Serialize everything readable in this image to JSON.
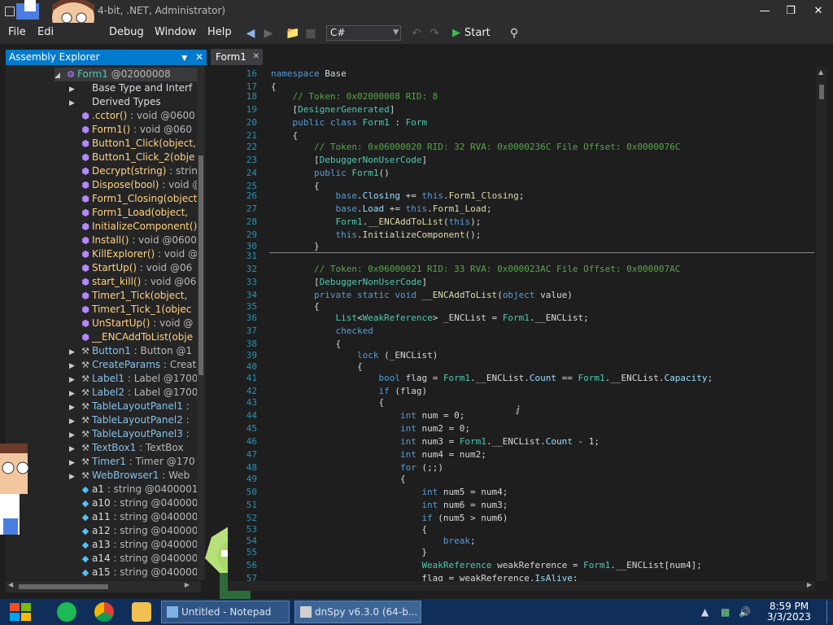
{
  "window": {
    "title": "4-bit, .NET, Administrator)",
    "minimize_label": "—",
    "maximize_label": "❐",
    "close_label": "✕"
  },
  "menu": {
    "file": "File",
    "edit": "Edi",
    "debug": "Debug",
    "window": "Window",
    "help": "Help"
  },
  "toolbar": {
    "language": "C#",
    "start_label": "Start",
    "icons": [
      "back-icon",
      "forward-icon",
      "open-folder-icon",
      "save-icon",
      "undo-icon",
      "redo-icon",
      "play-icon",
      "search-icon"
    ]
  },
  "assembly_explorer": {
    "title": "Assembly Explorer",
    "rows": [
      {
        "indent": 2,
        "expander": "◢",
        "icon": "class-icon",
        "name": "Form1",
        "sig": " @02000008",
        "kind": "type",
        "selected": true
      },
      {
        "indent": 3,
        "expander": "▶",
        "icon": "folder-icon",
        "name": "Base Type and Interf",
        "sig": "",
        "kind": "plain"
      },
      {
        "indent": 3,
        "expander": "▶",
        "icon": "folder-icon",
        "name": "Derived Types",
        "sig": "",
        "kind": "plain"
      },
      {
        "indent": 3,
        "expander": "",
        "icon": "method-icon",
        "name": ".cctor()",
        "sig": " : void @0600",
        "kind": "method"
      },
      {
        "indent": 3,
        "expander": "",
        "icon": "method-icon",
        "name": "Form1()",
        "sig": " : void @060",
        "kind": "method"
      },
      {
        "indent": 3,
        "expander": "",
        "icon": "method-icon",
        "name": "Button1_Click(object,",
        "sig": "",
        "kind": "method"
      },
      {
        "indent": 3,
        "expander": "",
        "icon": "method-icon",
        "name": "Button1_Click_2(obje",
        "sig": "",
        "kind": "method"
      },
      {
        "indent": 3,
        "expander": "",
        "icon": "method-icon",
        "name": "Decrypt(string)",
        "sig": " : strin",
        "kind": "method"
      },
      {
        "indent": 3,
        "expander": "",
        "icon": "method-icon",
        "name": "Dispose(bool)",
        "sig": " : void @",
        "kind": "method"
      },
      {
        "indent": 3,
        "expander": "",
        "icon": "method-icon",
        "name": "Form1_Closing(object",
        "sig": "",
        "kind": "method"
      },
      {
        "indent": 3,
        "expander": "",
        "icon": "method-icon",
        "name": "Form1_Load(object,",
        "sig": "",
        "kind": "method"
      },
      {
        "indent": 3,
        "expander": "",
        "icon": "method-icon",
        "name": "InitializeComponent()",
        "sig": "",
        "kind": "method"
      },
      {
        "indent": 3,
        "expander": "",
        "icon": "method-icon",
        "name": "Install()",
        "sig": " : void @0600",
        "kind": "method"
      },
      {
        "indent": 3,
        "expander": "",
        "icon": "method-icon",
        "name": "KillExplorer()",
        "sig": " : void @",
        "kind": "method"
      },
      {
        "indent": 3,
        "expander": "",
        "icon": "method-icon",
        "name": "StartUp()",
        "sig": " : void @06",
        "kind": "method"
      },
      {
        "indent": 3,
        "expander": "",
        "icon": "method-icon",
        "name": "start_kill()",
        "sig": " : void @06",
        "kind": "method"
      },
      {
        "indent": 3,
        "expander": "",
        "icon": "method-icon",
        "name": "Timer1_Tick(object,",
        "sig": "",
        "kind": "method"
      },
      {
        "indent": 3,
        "expander": "",
        "icon": "method-icon",
        "name": "Timer1_Tick_1(objec",
        "sig": "",
        "kind": "method"
      },
      {
        "indent": 3,
        "expander": "",
        "icon": "method-icon",
        "name": "UnStartUp()",
        "sig": " : void @",
        "kind": "method"
      },
      {
        "indent": 3,
        "expander": "",
        "icon": "method-icon",
        "name": "__ENCAddToList(obje",
        "sig": "",
        "kind": "method"
      },
      {
        "indent": 3,
        "expander": "▶",
        "icon": "property-icon",
        "name": "Button1",
        "sig": " : Button @1",
        "kind": "field"
      },
      {
        "indent": 3,
        "expander": "▶",
        "icon": "property-icon",
        "name": "CreateParams",
        "sig": " : Creat",
        "kind": "field"
      },
      {
        "indent": 3,
        "expander": "▶",
        "icon": "property-icon",
        "name": "Label1",
        "sig": " : Label @1700",
        "kind": "field"
      },
      {
        "indent": 3,
        "expander": "▶",
        "icon": "property-icon",
        "name": "Label2",
        "sig": " : Label @1700",
        "kind": "field"
      },
      {
        "indent": 3,
        "expander": "▶",
        "icon": "property-icon",
        "name": "TableLayoutPanel1",
        "sig": " :",
        "kind": "field"
      },
      {
        "indent": 3,
        "expander": "▶",
        "icon": "property-icon",
        "name": "TableLayoutPanel2",
        "sig": " :",
        "kind": "field"
      },
      {
        "indent": 3,
        "expander": "▶",
        "icon": "property-icon",
        "name": "TableLayoutPanel3",
        "sig": " :",
        "kind": "field"
      },
      {
        "indent": 3,
        "expander": "▶",
        "icon": "property-icon",
        "name": "TextBox1",
        "sig": " : TextBox",
        "kind": "field"
      },
      {
        "indent": 3,
        "expander": "▶",
        "icon": "property-icon",
        "name": "Timer1",
        "sig": " : Timer @170",
        "kind": "field"
      },
      {
        "indent": 3,
        "expander": "▶",
        "icon": "property-icon",
        "name": "WebBrowser1",
        "sig": " : Web",
        "kind": "field"
      },
      {
        "indent": 3,
        "expander": "",
        "icon": "field-icon",
        "name": "a1",
        "sig": " : string @0400001",
        "kind": "plainfield"
      },
      {
        "indent": 3,
        "expander": "",
        "icon": "field-icon",
        "name": "a10",
        "sig": " : string @040000",
        "kind": "plainfield"
      },
      {
        "indent": 3,
        "expander": "",
        "icon": "field-icon",
        "name": "a11",
        "sig": " : string @040000",
        "kind": "plainfield"
      },
      {
        "indent": 3,
        "expander": "",
        "icon": "field-icon",
        "name": "a12",
        "sig": " : string @040000",
        "kind": "plainfield"
      },
      {
        "indent": 3,
        "expander": "",
        "icon": "field-icon",
        "name": "a13",
        "sig": " : string @040000",
        "kind": "plainfield"
      },
      {
        "indent": 3,
        "expander": "",
        "icon": "field-icon",
        "name": "a14",
        "sig": " : string @040000",
        "kind": "plainfield"
      },
      {
        "indent": 3,
        "expander": "",
        "icon": "field-icon",
        "name": "a15",
        "sig": " : string @040000",
        "kind": "plainfield"
      }
    ]
  },
  "editor": {
    "tab_label": "Form1",
    "lines": [
      {
        "n": "16",
        "t": "namespace Base"
      },
      {
        "n": "17",
        "t": "{"
      },
      {
        "n": "18",
        "t": "    // Token: 0x02000008 RID: 8"
      },
      {
        "n": "19",
        "t": "    [DesignerGenerated]"
      },
      {
        "n": "20",
        "t": "    public class Form1 : Form"
      },
      {
        "n": "21",
        "t": "    {"
      },
      {
        "n": "22",
        "t": "        // Token: 0x06000020 RID: 32 RVA: 0x0000236C File Offset: 0x0000076C"
      },
      {
        "n": "23",
        "t": "        [DebuggerNonUserCode]"
      },
      {
        "n": "24",
        "t": "        public Form1()"
      },
      {
        "n": "25",
        "t": "        {"
      },
      {
        "n": "26",
        "t": "            base.Closing += this.Form1_Closing;"
      },
      {
        "n": "27",
        "t": "            base.Load += this.Form1_Load;"
      },
      {
        "n": "28",
        "t": "            Form1.__ENCAddToList(this);"
      },
      {
        "n": "29",
        "t": "            this.InitializeComponent();"
      },
      {
        "n": "30",
        "t": "        }"
      },
      {
        "n": "31",
        "t": ""
      },
      {
        "n": "32",
        "t": "        // Token: 0x06000021 RID: 33 RVA: 0x000023AC File Offset: 0x000007AC"
      },
      {
        "n": "33",
        "t": "        [DebuggerNonUserCode]"
      },
      {
        "n": "34",
        "t": "        private static void __ENCAddToList(object value)"
      },
      {
        "n": "35",
        "t": "        {"
      },
      {
        "n": "36",
        "t": "            List<WeakReference> _ENCList = Form1.__ENCList;"
      },
      {
        "n": "37",
        "t": "            checked"
      },
      {
        "n": "38",
        "t": "            {"
      },
      {
        "n": "39",
        "t": "                lock (_ENCList)"
      },
      {
        "n": "40",
        "t": "                {"
      },
      {
        "n": "41",
        "t": "                    bool flag = Form1.__ENCList.Count == Form1.__ENCList.Capacity;"
      },
      {
        "n": "42",
        "t": "                    if (flag)"
      },
      {
        "n": "43",
        "t": "                    {"
      },
      {
        "n": "44",
        "t": "                        int num = 0;"
      },
      {
        "n": "45",
        "t": "                        int num2 = 0;"
      },
      {
        "n": "46",
        "t": "                        int num3 = Form1.__ENCList.Count - 1;"
      },
      {
        "n": "47",
        "t": "                        int num4 = num2;"
      },
      {
        "n": "48",
        "t": "                        for (;;)"
      },
      {
        "n": "49",
        "t": "                        {"
      },
      {
        "n": "50",
        "t": "                            int num5 = num4;"
      },
      {
        "n": "51",
        "t": "                            int num6 = num3;"
      },
      {
        "n": "52",
        "t": "                            if (num5 > num6)"
      },
      {
        "n": "53",
        "t": "                            {"
      },
      {
        "n": "54",
        "t": "                                break;"
      },
      {
        "n": "55",
        "t": "                            }"
      },
      {
        "n": "56",
        "t": "                            WeakReference weakReference = Form1.__ENCList[num4];"
      },
      {
        "n": "57",
        "t": "                            flag = weakReference.IsAlive;"
      }
    ]
  },
  "taskbar": {
    "notepad_label": "Untitled - Notepad",
    "dnspy_label": "dnSpy v6.3.0 (64-b...",
    "time": "8:59 PM",
    "date": "3/3/2023"
  }
}
